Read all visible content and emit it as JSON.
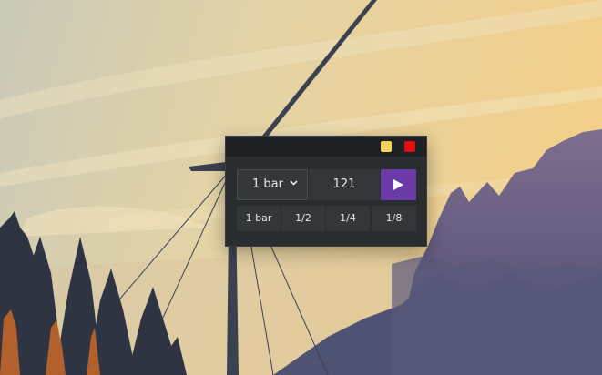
{
  "colors": {
    "minimize": "#f2d25a",
    "close": "#e01010",
    "play": "#6a3aa7",
    "panel": "#2a2d2f",
    "titlebar": "#1e2022"
  },
  "window": {
    "minimize_icon": "yellow-square-icon",
    "close_icon": "red-square-icon"
  },
  "controls": {
    "bar_select": {
      "selected": "1 bar",
      "icon": "chevron-down-icon"
    },
    "tempo": "121",
    "play_icon": "play-icon"
  },
  "divisions": [
    "1 bar",
    "1/2",
    "1/4",
    "1/8"
  ]
}
